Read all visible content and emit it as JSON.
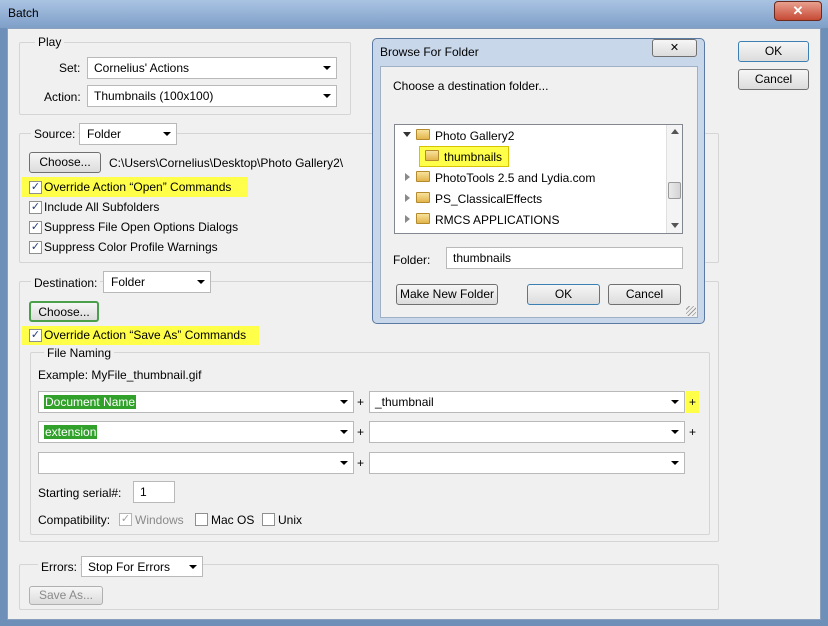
{
  "window": {
    "title": "Batch",
    "close_glyph": "✕"
  },
  "play": {
    "legend": "Play",
    "set_label": "Set:",
    "set_value": "Cornelius' Actions",
    "action_label": "Action:",
    "action_value": "Thumbnails (100x100)"
  },
  "buttons": {
    "ok": "OK",
    "cancel": "Cancel"
  },
  "source": {
    "label": "Source:",
    "value": "Folder",
    "choose": "Choose...",
    "path": "C:\\Users\\Cornelius\\Desktop\\Photo Gallery2\\",
    "options": [
      {
        "label": "Override Action “Open” Commands",
        "checked": true
      },
      {
        "label": "Include All Subfolders",
        "checked": true
      },
      {
        "label": "Suppress File Open Options Dialogs",
        "checked": true
      },
      {
        "label": "Suppress Color Profile Warnings",
        "checked": true
      }
    ]
  },
  "destination": {
    "label": "Destination:",
    "value": "Folder",
    "choose": "Choose...",
    "override": "Override Action “Save As” Commands",
    "file_naming": {
      "legend": "File Naming",
      "example": "Example: MyFile_thumbnail.gif",
      "rows": [
        {
          "left": "Document Name",
          "right": "_thumbnail"
        },
        {
          "left": "extension",
          "right": ""
        },
        {
          "left": "",
          "right": ""
        }
      ],
      "plus": "+",
      "serial_label": "Starting serial#:",
      "serial_value": "1",
      "compat_label": "Compatibility:",
      "compat": [
        {
          "label": "Windows",
          "checked": true,
          "disabled": true
        },
        {
          "label": "Mac OS",
          "checked": false,
          "disabled": false
        },
        {
          "label": "Unix",
          "checked": false,
          "disabled": false
        }
      ]
    }
  },
  "errors": {
    "label": "Errors:",
    "value": "Stop For Errors",
    "save_as": "Save As..."
  },
  "browse": {
    "title": "Browse For Folder",
    "close_glyph": "✕",
    "prompt": "Choose a destination folder...",
    "tree": [
      "Photo Gallery2",
      "thumbnails",
      "PhotoTools 2.5 and Lydia.com",
      "PS_ClassicalEffects",
      "RMCS APPLICATIONS"
    ],
    "folder_label": "Folder:",
    "folder_value": "thumbnails",
    "make_new": "Make New Folder",
    "ok": "OK",
    "cancel": "Cancel"
  }
}
